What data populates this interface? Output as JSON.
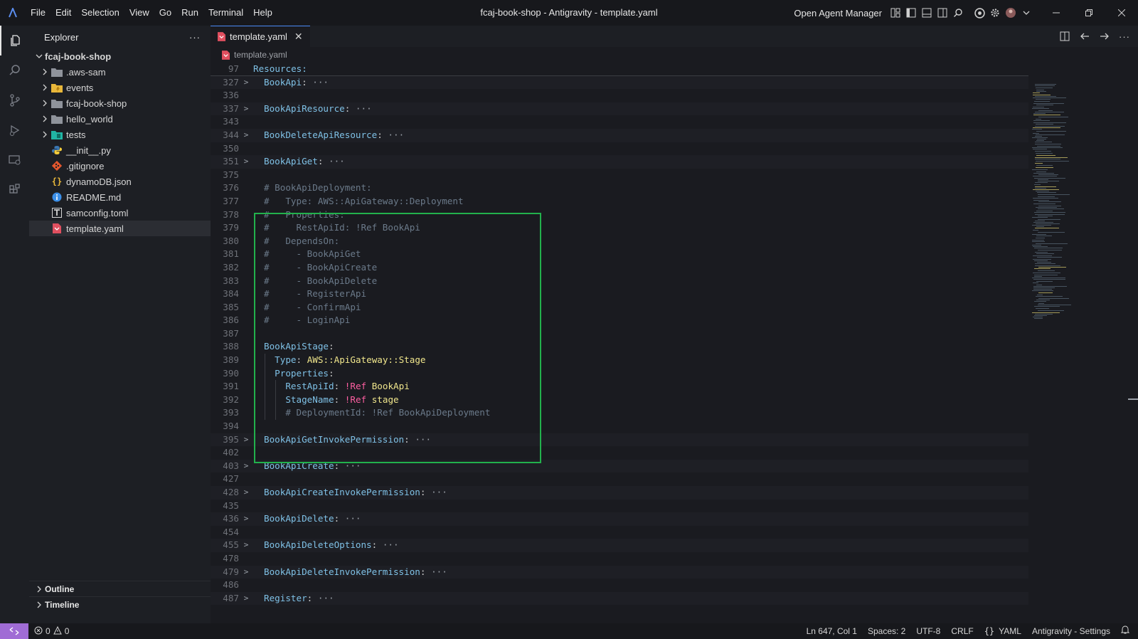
{
  "titlebar": {
    "menus": [
      "File",
      "Edit",
      "Selection",
      "View",
      "Go",
      "Run",
      "Terminal",
      "Help"
    ],
    "title": "fcaj-book-shop - Antigravity - template.yaml",
    "agent_manager": "Open Agent Manager"
  },
  "sidebar": {
    "title": "Explorer",
    "root": "fcaj-book-shop",
    "items": [
      {
        "label": ".aws-sam",
        "type": "folder"
      },
      {
        "label": "events",
        "type": "folder"
      },
      {
        "label": "fcaj-book-shop",
        "type": "folder"
      },
      {
        "label": "hello_world",
        "type": "folder"
      },
      {
        "label": "tests",
        "type": "folder"
      },
      {
        "label": "__init__.py",
        "type": "file"
      },
      {
        "label": ".gitignore",
        "type": "file"
      },
      {
        "label": "dynamoDB.json",
        "type": "file"
      },
      {
        "label": "README.md",
        "type": "file"
      },
      {
        "label": "samconfig.toml",
        "type": "file"
      },
      {
        "label": "template.yaml",
        "type": "file"
      }
    ],
    "outline": "Outline",
    "timeline": "Timeline"
  },
  "editor": {
    "tab": "template.yaml",
    "breadcrumb": "template.yaml",
    "sticky": {
      "num": "97",
      "text": "Resources:"
    }
  },
  "statusbar": {
    "errors": "0",
    "warnings": "0",
    "position": "Ln 647, Col 1",
    "spaces": "Spaces: 2",
    "encoding": "UTF-8",
    "eol": "CRLF",
    "language": "YAML",
    "settings": "Antigravity - Settings"
  },
  "colors": {
    "accent": "#4a8cf7",
    "highlight_box": "#22b14c",
    "remote": "#a06cd5"
  }
}
